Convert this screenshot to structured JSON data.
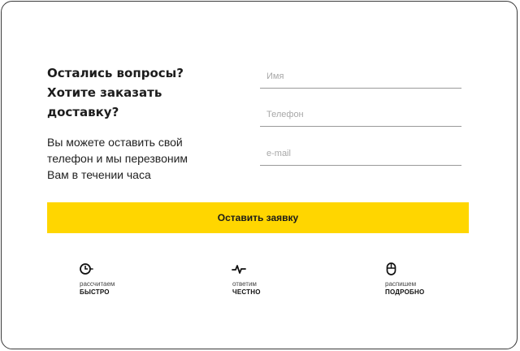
{
  "form": {
    "heading": {
      "line1": "Остались вопросы?",
      "line2": "Хотите заказать",
      "line3": "доставку?"
    },
    "description": {
      "line1": "Вы можете оставить свой",
      "line2": "телефон и мы перезвоним",
      "line3": "Вам в течении часа"
    },
    "fields": {
      "name_placeholder": "Имя",
      "phone_placeholder": "Телефон",
      "email_placeholder": "e-mail"
    },
    "submit_label": "Оставить заявку"
  },
  "features": [
    {
      "icon": "clock-icon",
      "small": "рассчитаем",
      "big": "БЫСТРО"
    },
    {
      "icon": "pulse-icon",
      "small": "ответим",
      "big": "ЧЕСТНО"
    },
    {
      "icon": "mouse-icon",
      "small": "распишем",
      "big": "ПОДРОБНО"
    }
  ],
  "colors": {
    "accent": "#ffd600",
    "border": "#3a3a3a",
    "field_line": "#9a9a9a"
  }
}
